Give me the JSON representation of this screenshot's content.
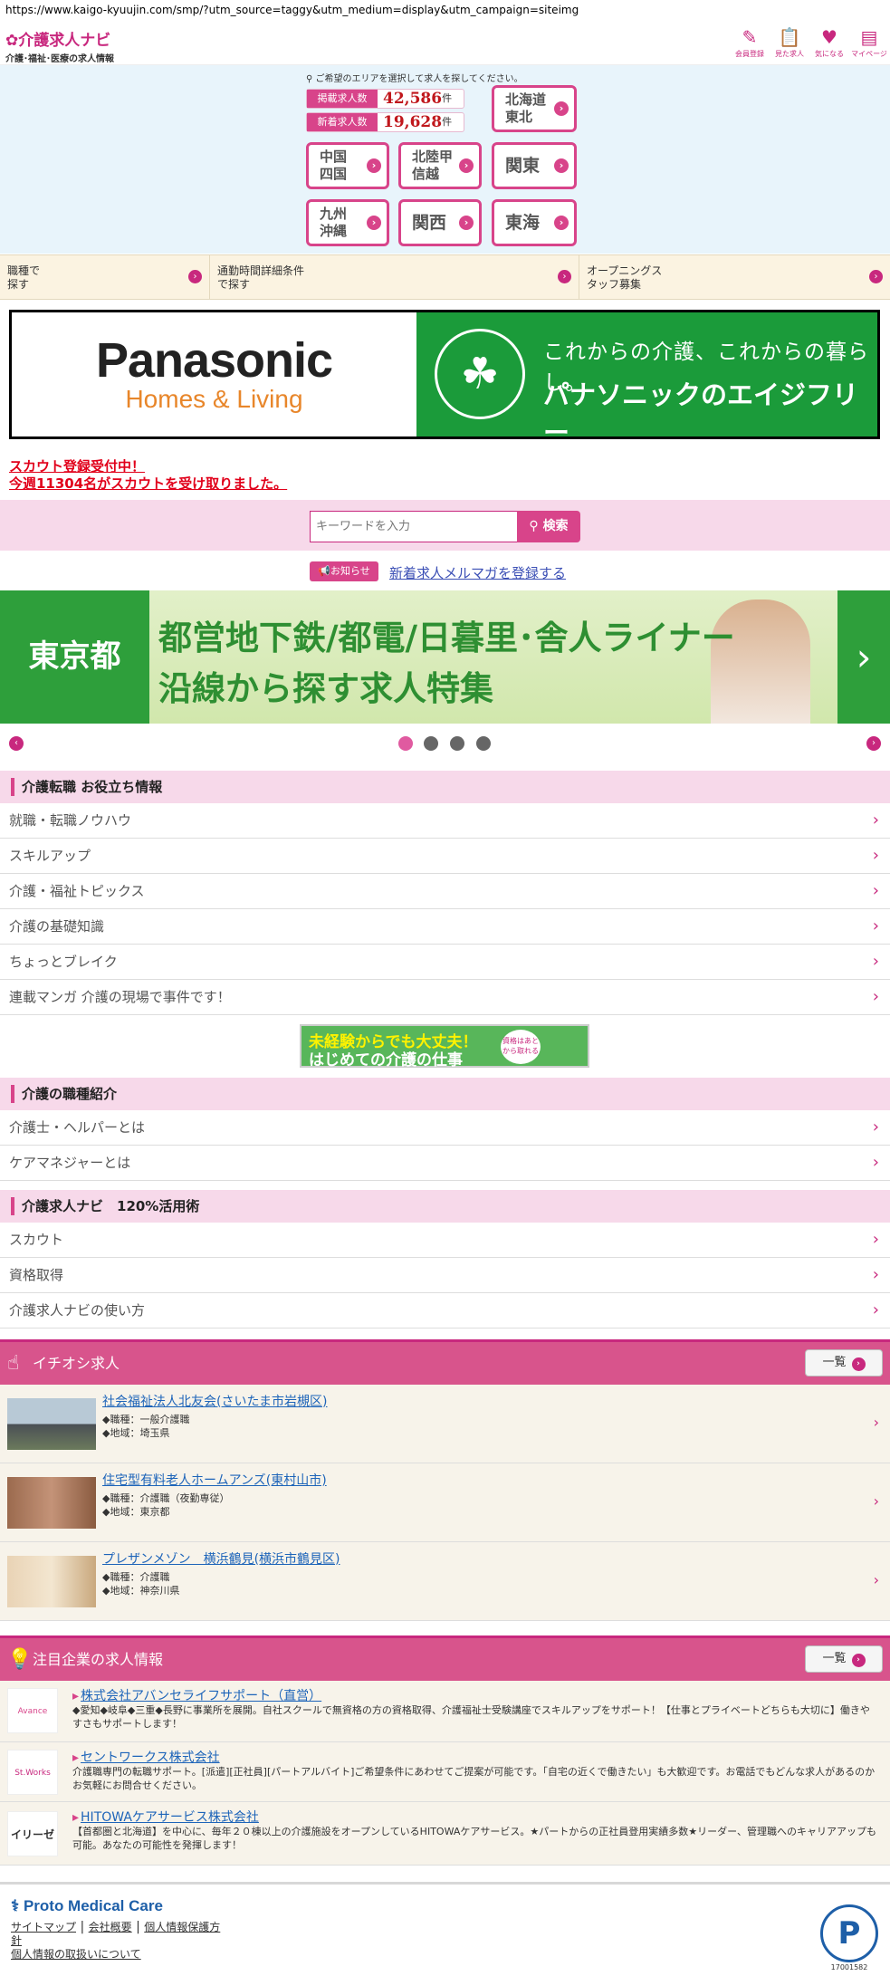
{
  "browser": {
    "url": "https://www.kaigo-kyuujin.com/smp/?utm_source=taggy&utm_medium=display&utm_campaign=siteimg"
  },
  "header": {
    "logo_title": "介護求人ナビ",
    "logo_sub": "介護･福祉･医療の求人情報",
    "icons": [
      {
        "label": "会員登録",
        "icon": "pencil-icon"
      },
      {
        "label": "見た求人",
        "icon": "clipboard-icon"
      },
      {
        "label": "気になる",
        "icon": "heart-icon"
      },
      {
        "label": "マイページ",
        "icon": "id-card-icon"
      }
    ]
  },
  "area": {
    "hint": "ご希望のエリアを選択して求人を探してください。",
    "listed_label": "掲載求人数",
    "listed_count": "42,586",
    "listed_unit": "件",
    "new_label": "新着求人数",
    "new_count": "19,628",
    "new_unit": "件",
    "regions": [
      "北海道東北",
      "中国四国",
      "北陸甲信越",
      "関東",
      "九州沖縄",
      "関西",
      "東海"
    ]
  },
  "subnav": [
    {
      "label": "職種で探す"
    },
    {
      "label": "通勤時間詳細条件で探す"
    },
    {
      "label": "オープニングスタッフ募集"
    }
  ],
  "ad": {
    "brand": "Panasonic",
    "brand_sub": "Homes & Living",
    "tagline": "これからの介護、これからの暮らし。",
    "service": "パナソニックのエイジフリー"
  },
  "scout": {
    "line1": "スカウト登録受付中！",
    "line2": "今週11304名がスカウトを受け取りました。"
  },
  "search": {
    "placeholder": "キーワードを入力",
    "button": "検索"
  },
  "news": {
    "badge": "お知らせ",
    "link": "新着求人メルマガを登録する"
  },
  "banner": {
    "pref": "東京都",
    "line1": "都営地下鉄/都電/日暮里･舎人ライナー",
    "line2": "沿線から探す求人特集",
    "arrow": "›"
  },
  "carousel": {
    "prev": "‹",
    "next": "›"
  },
  "section1": {
    "title": "介護転職 お役立ち情報",
    "items": [
      "就職・転職ノウハウ",
      "スキルアップ",
      "介護・福祉トピックス",
      "介護の基礎知識",
      "ちょっとブレイク",
      "連載マンガ 介護の現場で事件です！"
    ]
  },
  "mikeiken": {
    "line1": "未経験からでも大丈夫！",
    "line2": "はじめての介護の仕事",
    "bubble": "資格はあとから取れる"
  },
  "section2": {
    "title": "介護の職種紹介",
    "items": [
      "介護士・ヘルパーとは",
      "ケアマネジャーとは"
    ]
  },
  "section3": {
    "title": "介護求人ナビ　120%活用術",
    "items": [
      "スカウト",
      "資格取得",
      "介護求人ナビの使い方"
    ]
  },
  "pickup": {
    "title": "イチオシ求人",
    "more": "一覧",
    "jobs": [
      {
        "title": "社会福祉法人北友会(さいたま市岩槻区)",
        "job": "◆職種：一般介護職",
        "area": "◆地域：埼玉県"
      },
      {
        "title": "住宅型有料老人ホームアンズ(東村山市)",
        "job": "◆職種：介護職（夜勤専従）",
        "area": "◆地域：東京都"
      },
      {
        "title": "プレザンメゾン　横浜鶴見(横浜市鶴見区)",
        "job": "◆職種：介護職",
        "area": "◆地域：神奈川県"
      }
    ]
  },
  "featured": {
    "title": "注目企業の求人情報",
    "more": "一覧",
    "companies": [
      {
        "name": "株式会社アバンセライフサポート（直営）",
        "desc": "◆愛知◆岐阜◆三重◆長野に事業所を展開。自社スクールで無資格の方の資格取得、介護福祉士受験講座でスキルアップをサポート！【仕事とプライベートどちらも大切に】働きやすさもサポートします！",
        "logo": "Avance"
      },
      {
        "name": "セントワークス株式会社",
        "desc": "介護職専門の転職サポート。[派遣][正社員][パートアルバイト]ご希望条件にあわせてご提案が可能です。「自宅の近くで働きたい」も大歓迎です。お電話でもどんな求人があるのかお気軽にお問合せください。",
        "logo": "St.Works"
      },
      {
        "name": "HITOWAケアサービス株式会社",
        "desc": "【首都圏と北海道】を中心に、毎年２０棟以上の介護施設をオープンしているHITOWAケアサービス。★パートからの正社員登用実績多数★リーダー、管理職へのキャリアアップも可能。あなたの可能性を発揮します！",
        "logo": "イリーゼ"
      }
    ]
  },
  "footer": {
    "brand": "Proto Medical Care",
    "links": [
      "サイトマップ",
      "会社概要",
      "個人情報保護方針",
      "個人情報の取扱いについて"
    ],
    "privacy_num": "17001582"
  },
  "colors": {
    "brand": "#d8448a",
    "ad_green": "#1b9b3a",
    "banner_green": "#2e9f3b"
  }
}
